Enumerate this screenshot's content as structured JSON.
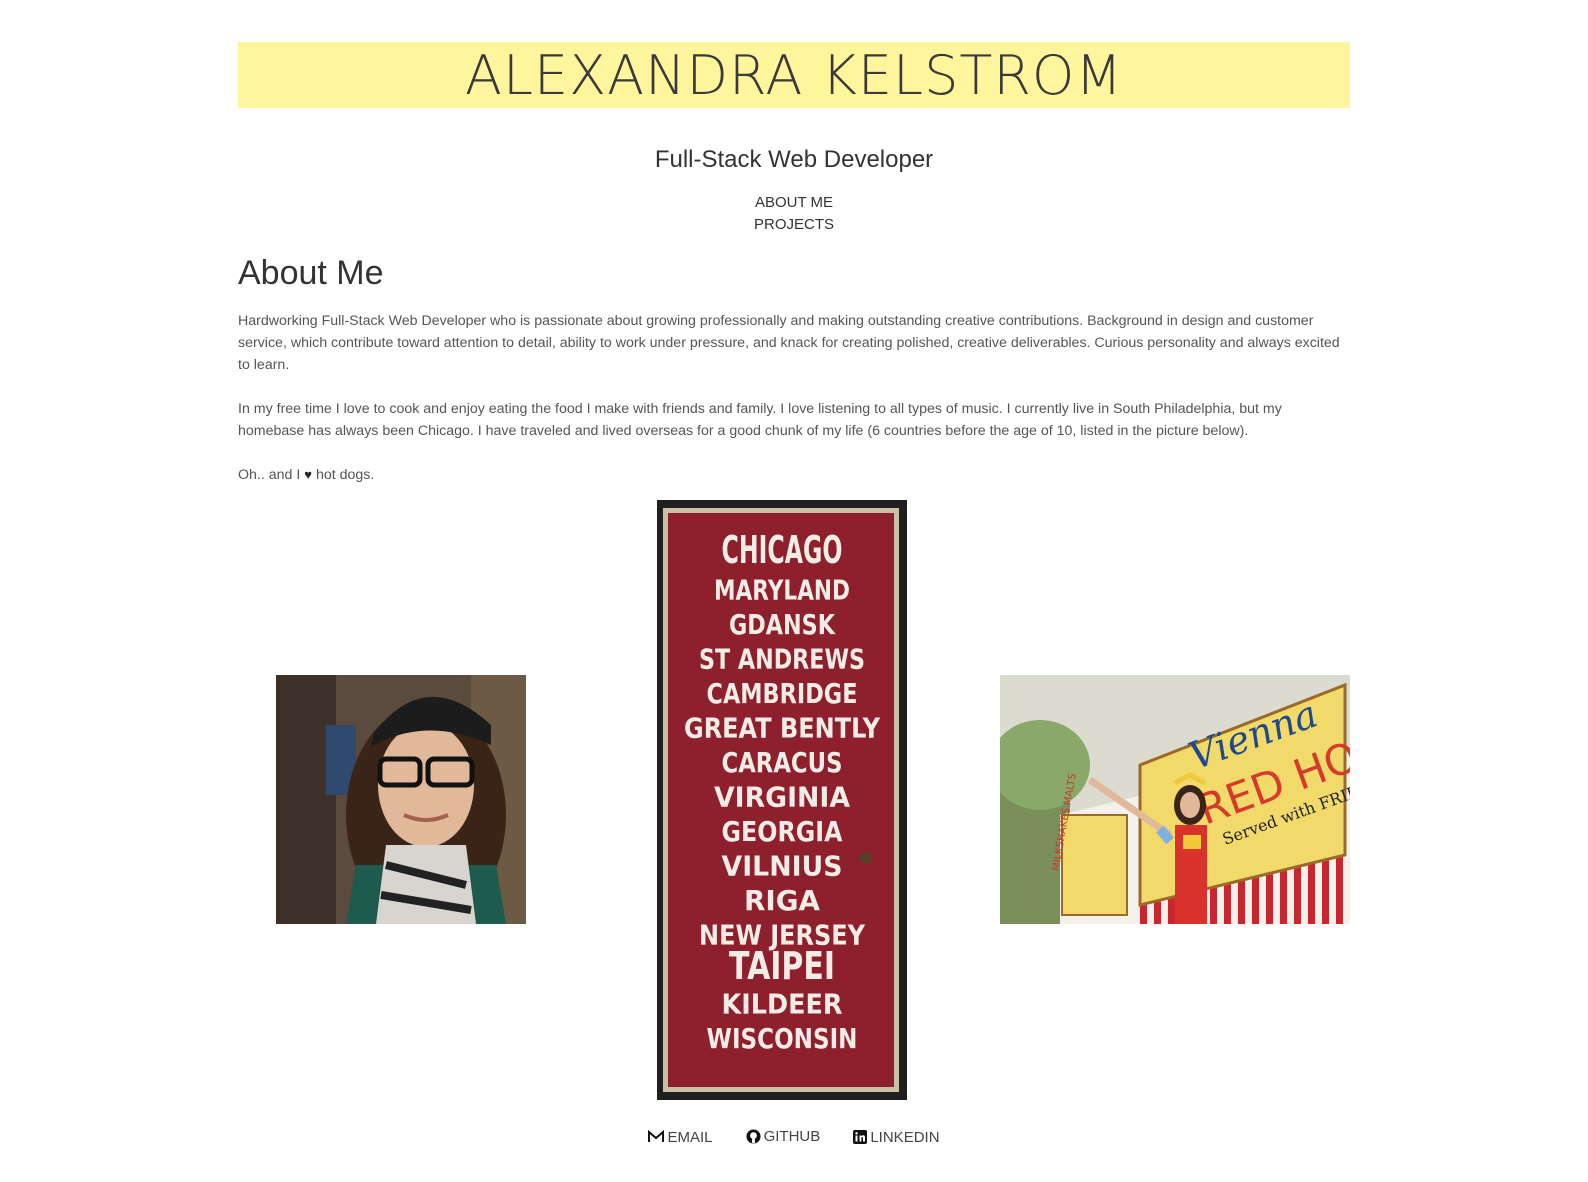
{
  "header": {
    "name": "ALEXANDRA KELSTROM",
    "subtitle": "Full-Stack Web Developer"
  },
  "nav": {
    "items": [
      {
        "label": "ABOUT ME"
      },
      {
        "label": "PROJECTS"
      }
    ]
  },
  "about": {
    "title": "About Me",
    "p1": "Hardworking Full-Stack Web Developer who is passionate about growing professionally and making outstanding creative contributions. Background in design and customer service, which contribute toward attention to detail, ability to work under pressure, and knack for creating polished, creative deliverables. Curious personality and always excited to learn.",
    "p2": "In my free time I love to cook and enjoy eating the food I make with friends and family. I love listening to all types of music. I currently live in South Philadelphia, but my homebase has always been Chicago. I have traveled and lived overseas for a good chunk of my life (6 countries before the age of 10, listed in the picture below).",
    "p3_before": "Oh.. and I",
    "p3_after": "hot dogs."
  },
  "photos": {
    "sign_words": [
      "CHICAGO",
      "MARYLAND",
      "GDANSK",
      "ST ANDREWS",
      "CAMBRIDGE",
      "GREAT BENTLY",
      "CARACUS",
      "VIRGINIA",
      "GEORGIA",
      "VILNIUS",
      "RIGA",
      "NEW JERSEY",
      "TAIPEI",
      "KILDEER",
      "WISCONSIN"
    ],
    "hotdog_sign": {
      "line1": "Vienna",
      "line2": "RED HOTS",
      "line3": "Served with FRIES",
      "side": "MILKSHAKES MALTS"
    }
  },
  "footer": {
    "email": "EMAIL",
    "github": "GITHUB",
    "linkedin": "LINKEDIN"
  },
  "colors": {
    "banner": "#fff59d",
    "sign_red": "#8e1f2c"
  }
}
